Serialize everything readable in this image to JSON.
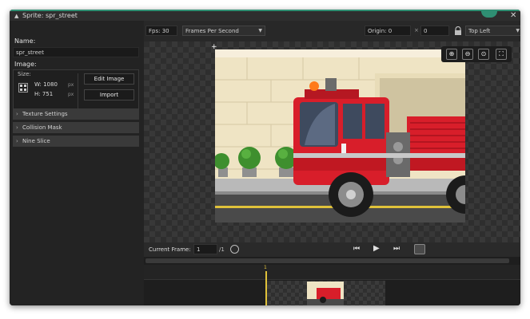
{
  "window": {
    "title": "Sprite: spr_street",
    "accent_color": "#2f8f73"
  },
  "left_panel": {
    "name_label": "Name:",
    "name_value": "spr_street",
    "image_label": "Image:",
    "size_label": "Size:",
    "width_value": "W: 1080",
    "height_value": "H: 751",
    "px_unit": "px",
    "edit_image_button": "Edit Image",
    "import_button": "Import",
    "sections": [
      {
        "label": "Texture Settings"
      },
      {
        "label": "Collision Mask"
      },
      {
        "label": "Nine Slice"
      }
    ]
  },
  "toolbar": {
    "fps_label": "Fps: 30",
    "speed_mode": "Frames Per Second",
    "origin_label": "Origin: 0",
    "origin_y": "0",
    "origin_preset": "Top Left",
    "lock_icon": "lock-icon"
  },
  "canvas": {
    "zoom_icons": [
      "zoom-in-icon",
      "zoom-out-icon",
      "zoom-fit-icon",
      "fullscreen-icon"
    ]
  },
  "playback": {
    "current_frame_label": "Current Frame:",
    "current_frame_value": "1",
    "total_frames": "/1"
  },
  "timeline": {
    "marker_label": "1"
  }
}
